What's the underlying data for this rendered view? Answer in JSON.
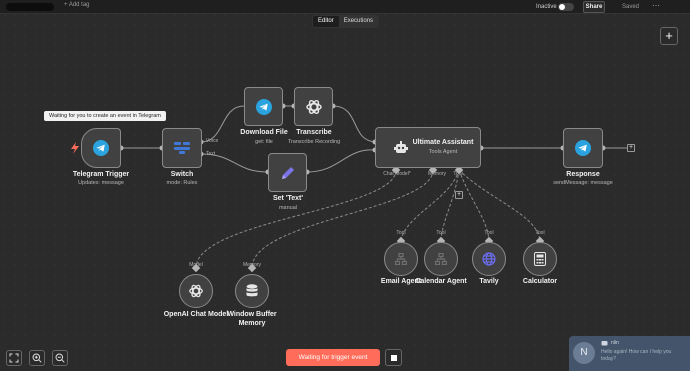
{
  "topbar": {
    "add_tag": "+ Add tag",
    "status": "Inactive",
    "share": "Share",
    "saved": "Saved",
    "more": "⋯"
  },
  "tabs": [
    "Editor",
    "Executions"
  ],
  "canvas_add": "+",
  "tooltip": "Waiting for you to create an event in Telegram",
  "nodes": {
    "telegram_trigger": {
      "title": "Telegram Trigger",
      "subtitle": "Updates: message"
    },
    "switch": {
      "title": "Switch",
      "subtitle": "mode: Rules",
      "outputs": [
        "Voice",
        "Text"
      ]
    },
    "download_file": {
      "title": "Download File",
      "subtitle": "get: file"
    },
    "transcribe": {
      "title": "Transcribe",
      "subtitle": "Transcribe Recording"
    },
    "set_text": {
      "title": "Set 'Text'",
      "subtitle": "manual"
    },
    "ultimate_assistant": {
      "title": "Ultimate Assistant",
      "subtitle": "Tools Agent",
      "ports": [
        "Chat Model*",
        "Memory",
        "Tool"
      ]
    },
    "response": {
      "title": "Response",
      "subtitle": "sendMessage: message"
    },
    "openai_chat_model": {
      "title": "OpenAI Chat Model",
      "port": "Model"
    },
    "window_buffer_memory": {
      "title_line1": "Window Buffer",
      "title_line2": "Memory",
      "port": "Memory"
    },
    "email_agent": {
      "title": "Email Agent",
      "port": "Tool"
    },
    "calendar_agent": {
      "title": "Calendar Agent",
      "port": "Tool"
    },
    "tavily": {
      "title": "Tavily",
      "port": "Tool"
    },
    "calculator": {
      "title": "Calculator",
      "port": "Tool"
    }
  },
  "bottom": {
    "trigger_button": "Waiting for trigger event"
  },
  "chat": {
    "avatar": "N",
    "name": "nlin",
    "message": "Hello again! How can I help you today?"
  },
  "colors": {
    "accent": "#ff6d5a",
    "telegram": "#2aa3df",
    "switch": "#3f78d6",
    "set": "#7b74e8",
    "globe": "#6c6cf0"
  }
}
